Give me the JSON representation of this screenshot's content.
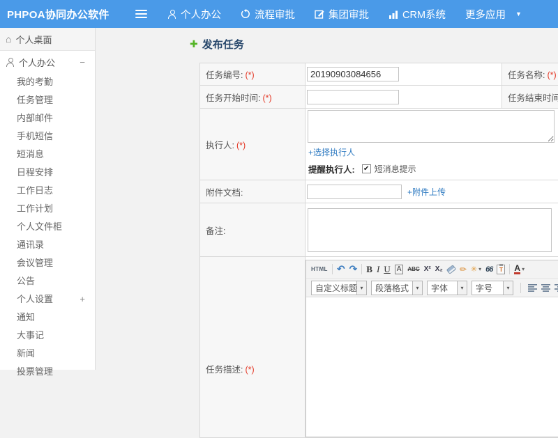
{
  "topbar": {
    "logo": "PHPOA协同办公软件",
    "nav": [
      {
        "label": "个人办公",
        "icon": "user-icon"
      },
      {
        "label": "流程审批",
        "icon": "process-icon"
      },
      {
        "label": "集团审批",
        "icon": "edit-icon"
      },
      {
        "label": "CRM系统",
        "icon": "chart-icon"
      },
      {
        "label": "更多应用",
        "icon": "caret-down-icon"
      }
    ]
  },
  "sidebar": {
    "items": [
      {
        "label": "个人桌面",
        "icon": "home-icon"
      },
      {
        "label": "个人办公",
        "icon": "user-icon",
        "toggle": "−"
      },
      {
        "label": "我的考勤"
      },
      {
        "label": "任务管理"
      },
      {
        "label": "内部邮件"
      },
      {
        "label": "手机短信"
      },
      {
        "label": "短消息"
      },
      {
        "label": "日程安排"
      },
      {
        "label": "工作日志"
      },
      {
        "label": "工作计划"
      },
      {
        "label": "个人文件柜"
      },
      {
        "label": "通讯录"
      },
      {
        "label": "会议管理"
      },
      {
        "label": "公告"
      },
      {
        "label": "个人设置",
        "toggle": "+"
      },
      {
        "label": "通知"
      },
      {
        "label": "大事记"
      },
      {
        "label": "新闻"
      },
      {
        "label": "投票管理"
      }
    ]
  },
  "page": {
    "title": "发布任务"
  },
  "form": {
    "task_no": {
      "label": "任务编号:",
      "required": "(*)",
      "value": "20190903084656"
    },
    "task_name": {
      "label": "任务名称:",
      "required": "(*)"
    },
    "start_time": {
      "label": "任务开始时间:",
      "required": "(*)"
    },
    "end_time": {
      "label": "任务结束时间:",
      "required": "(*)"
    },
    "executor": {
      "label": "执行人:",
      "required": "(*)",
      "select_link": "+选择执行人",
      "remind_label": "提醒执行人:",
      "sms_label": "短消息提示",
      "sms_checked": true
    },
    "attachment": {
      "label": "附件文档:",
      "upload_link": "+附件上传"
    },
    "remark": {
      "label": "备注:"
    },
    "description": {
      "label": "任务描述:",
      "required": "(*)"
    }
  },
  "editor": {
    "toolbar": {
      "html": "HTML",
      "undo": "↶",
      "redo": "↷",
      "bold": "B",
      "italic": "I",
      "underline": "U",
      "font_box": "A",
      "strike": "ABC",
      "sup": "X²",
      "sub": "X₂",
      "sparkle": "✳",
      "brush": "✏",
      "quote": "66",
      "paste_t": "T",
      "font_color": "A",
      "caret": "▾"
    },
    "selects": [
      {
        "label": "自定义标题"
      },
      {
        "label": "段落格式"
      },
      {
        "label": "字体"
      },
      {
        "label": "字号"
      }
    ]
  },
  "icons": {
    "caret_down": "▼",
    "home": "⌂",
    "plus_green": "✚",
    "check": "✔",
    "minus": "−",
    "plus": "+"
  },
  "colors": {
    "topbar": "#4a9ae8",
    "link": "#2e7ac1",
    "required": "#e43a28",
    "title": "#27476b",
    "plus_icon": "#54b426"
  }
}
